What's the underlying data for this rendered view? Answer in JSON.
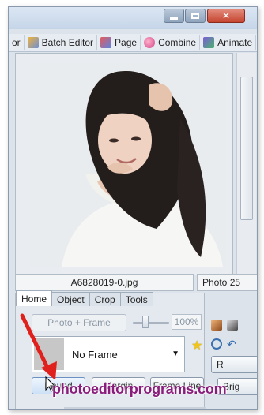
{
  "toolbar_tabs": [
    {
      "label": "or",
      "icon": ""
    },
    {
      "label": "Batch Editor",
      "icon": "batch-editor-icon"
    },
    {
      "label": "Page",
      "icon": "page-icon"
    },
    {
      "label": "Combine",
      "icon": "combine-icon"
    },
    {
      "label": "Animate",
      "icon": "animate-icon"
    }
  ],
  "preview": {
    "filename": "A6828019-0.jpg",
    "info": "Photo 25"
  },
  "panel": {
    "tabs": [
      "Home",
      "Object",
      "Crop",
      "Tools"
    ],
    "active_tab": "Home",
    "photo_frame_label": "Photo + Frame",
    "opacity_value": "100%",
    "frame_value": "No Frame",
    "buttons": {
      "round": "Round",
      "margin": "Margin",
      "frame_line": "Frame Line"
    }
  },
  "right_panel": {
    "btn1": "R",
    "btn2": "Brig"
  },
  "watermark": "photoeditorprograms.com",
  "colors": {
    "watermark": "#8a1c7c",
    "arrow": "#e0201c",
    "star": "#f0c419"
  }
}
